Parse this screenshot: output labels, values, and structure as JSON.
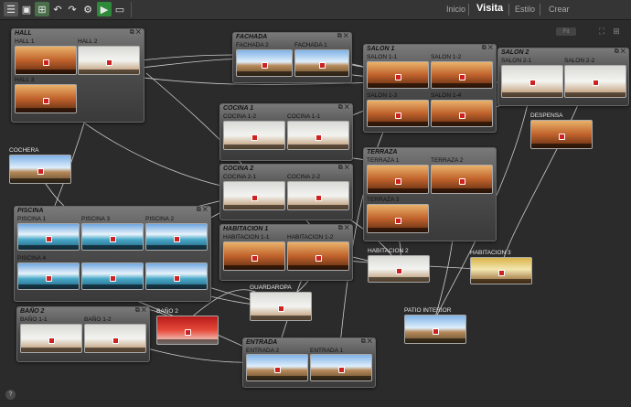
{
  "toolbar": {
    "icons": [
      "menu-icon",
      "save-icon",
      "export-icon",
      "undo-icon",
      "redo-icon",
      "settings-icon",
      "play-icon",
      "window-icon"
    ],
    "nav": [
      "Inicio",
      "Visita",
      "Estilo",
      "Crear"
    ],
    "active_nav": "Visita",
    "zoom_label": "Fit"
  },
  "groups": [
    {
      "id": "hall",
      "title": "HALL",
      "panos": [
        {
          "label": "HALL 1",
          "style": "wood"
        },
        {
          "label": "HALL 2",
          "style": "white"
        },
        {
          "label": "HALL 3",
          "style": "wood"
        }
      ]
    },
    {
      "id": "fachada",
      "title": "FACHADA",
      "panos": [
        {
          "label": "FACHADA 2",
          "style": "sky"
        },
        {
          "label": "FACHADA 1",
          "style": "sky"
        }
      ]
    },
    {
      "id": "salon1",
      "title": "SALON 1",
      "panos": [
        {
          "label": "SALON 1-1",
          "style": "wood"
        },
        {
          "label": "SALON 1-2",
          "style": "wood"
        },
        {
          "label": "SALON 1-3",
          "style": "wood"
        },
        {
          "label": "SALON 1-4",
          "style": "wood"
        }
      ]
    },
    {
      "id": "salon2",
      "title": "SALON 2",
      "panos": [
        {
          "label": "SALON 2-1",
          "style": "white"
        },
        {
          "label": "SALON 2-2",
          "style": "white"
        }
      ]
    },
    {
      "id": "cocina1",
      "title": "COCINA 1",
      "panos": [
        {
          "label": "COCINA 1-2",
          "style": "white"
        },
        {
          "label": "COCINA 1-1",
          "style": "white"
        }
      ]
    },
    {
      "id": "cocina2",
      "title": "COCINA 2",
      "panos": [
        {
          "label": "COCINA 2-1",
          "style": "white"
        },
        {
          "label": "COCINA 2-2",
          "style": "white"
        }
      ]
    },
    {
      "id": "terraza",
      "title": "TERRAZA",
      "panos": [
        {
          "label": "TERRAZA 1",
          "style": "wood"
        },
        {
          "label": "TERRAZA 2",
          "style": "wood"
        },
        {
          "label": "TERRAZA 3",
          "style": "wood"
        }
      ]
    },
    {
      "id": "piscina",
      "title": "PISCINA",
      "panos": [
        {
          "label": "PISCINA 1",
          "style": "pool"
        },
        {
          "label": "PISCINA 3",
          "style": "pool"
        },
        {
          "label": "PISCINA 2",
          "style": "pool"
        },
        {
          "label": "PISCINA 4",
          "style": "pool"
        },
        {
          "label": "",
          "style": "pool"
        },
        {
          "label": "",
          "style": "pool"
        }
      ]
    },
    {
      "id": "habitacion1",
      "title": "HABITACION 1",
      "panos": [
        {
          "label": "HABITACION 1-1",
          "style": "wood"
        },
        {
          "label": "HABITACION 1-2",
          "style": "wood"
        }
      ]
    },
    {
      "id": "bano",
      "title": "BAÑO 2",
      "panos": [
        {
          "label": "BAÑO 1-1",
          "style": "white"
        },
        {
          "label": "BAÑO 1-2",
          "style": "white"
        }
      ]
    },
    {
      "id": "entrada",
      "title": "ENTRADA",
      "panos": [
        {
          "label": "ENTRADA 2",
          "style": "sky"
        },
        {
          "label": "ENTRADA 1",
          "style": "sky"
        }
      ]
    }
  ],
  "standalone": [
    {
      "label": "COCHERA",
      "style": "sky"
    },
    {
      "label": "DESPENSA",
      "style": "wood"
    },
    {
      "label": "HABITACION 2",
      "style": "white"
    },
    {
      "label": "HABITACION 3",
      "style": "yellow"
    },
    {
      "label": "GUARDAROPA",
      "style": "white"
    },
    {
      "label": "BAÑO 2",
      "style": "red"
    },
    {
      "label": "PATIO INTERIOR",
      "style": "sky"
    }
  ],
  "group_controls": "⧉ ✕",
  "help_label": "?"
}
